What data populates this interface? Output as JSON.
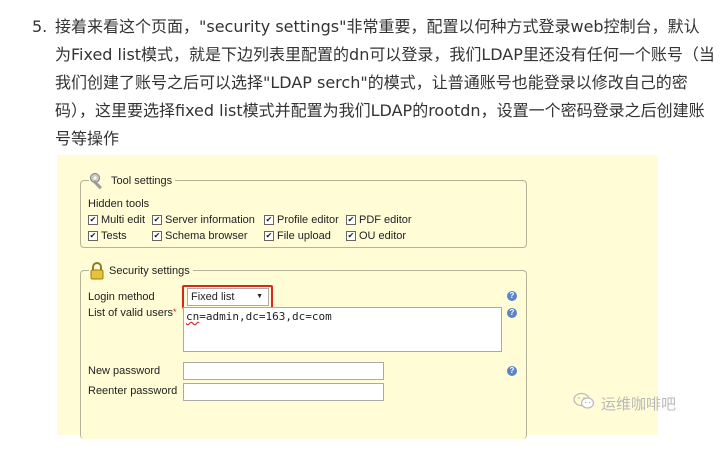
{
  "article": {
    "number": "5.",
    "paragraph": "接着来看这个页面，\"security settings\"非常重要，配置以何种方式登录web控制台，默认为Fixed list模式，就是下边列表里配置的dn可以登录，我们LDAP里还没有任何一个账号（当我们创建了账号之后可以选择\"LDAP serch\"的模式，让普通账号也能登录以修改自己的密码），这里要选择fixed list模式并配置为我们LDAP的rootdn，设置一个密码登录之后创建账号等操作"
  },
  "tool_settings": {
    "title": "Tool settings",
    "hidden_tools_label": "Hidden tools",
    "checkboxes": [
      {
        "label": "Multi edit",
        "checked": true
      },
      {
        "label": "Server information",
        "checked": true
      },
      {
        "label": "Profile editor",
        "checked": true
      },
      {
        "label": "PDF editor",
        "checked": true
      },
      {
        "label": "Tests",
        "checked": true
      },
      {
        "label": "Schema browser",
        "checked": true
      },
      {
        "label": "File upload",
        "checked": true
      },
      {
        "label": "OU editor",
        "checked": true
      }
    ]
  },
  "security_settings": {
    "title": "Security settings",
    "login_method_label": "Login method",
    "login_method_value": "Fixed list",
    "valid_users_label": "List of valid users",
    "required_mark": "*",
    "valid_users_value_cn": "cn",
    "valid_users_value_rest": "=admin,dc=163,dc=com",
    "new_password_label": "New password",
    "reenter_password_label": "Reenter password"
  },
  "help_glyph": "?",
  "checkmark_glyph": "✔",
  "select_arrow_glyph": "▼",
  "watermark": {
    "text": "运维咖啡吧"
  },
  "colors": {
    "highlight": "#d62b1c",
    "panel": "#fffcd6",
    "help": "#5b84c9"
  }
}
